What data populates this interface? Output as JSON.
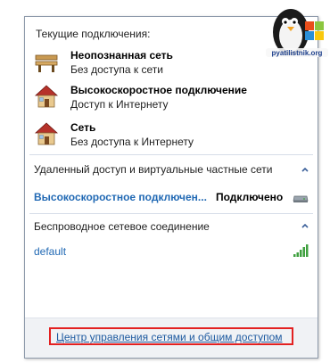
{
  "header": {
    "title": "Текущие подключения:"
  },
  "connections": [
    {
      "name": "Неопознанная сеть",
      "status": "Без доступа к сети",
      "icon": "bench-icon"
    },
    {
      "name": "Высокоскоростное подключение",
      "status": "Доступ к Интернету",
      "icon": "house-icon"
    },
    {
      "name": "Сеть",
      "status": "Без доступа к Интернету",
      "icon": "house-icon"
    }
  ],
  "vpn_section": {
    "title": "Удаленный доступ и виртуальные частные сети",
    "item_name": "Высокоскоростное подключен...",
    "item_status": "Подключено"
  },
  "wifi_section": {
    "title": "Беспроводное сетевое соединение",
    "network": "default"
  },
  "footer": {
    "link": "Центр управления сетями и общим доступом"
  },
  "logo": {
    "text": "pyatilistnik.org"
  },
  "colors": {
    "link": "#2169b4",
    "highlight": "#e32121",
    "footer_bg": "#f0f2f5"
  }
}
